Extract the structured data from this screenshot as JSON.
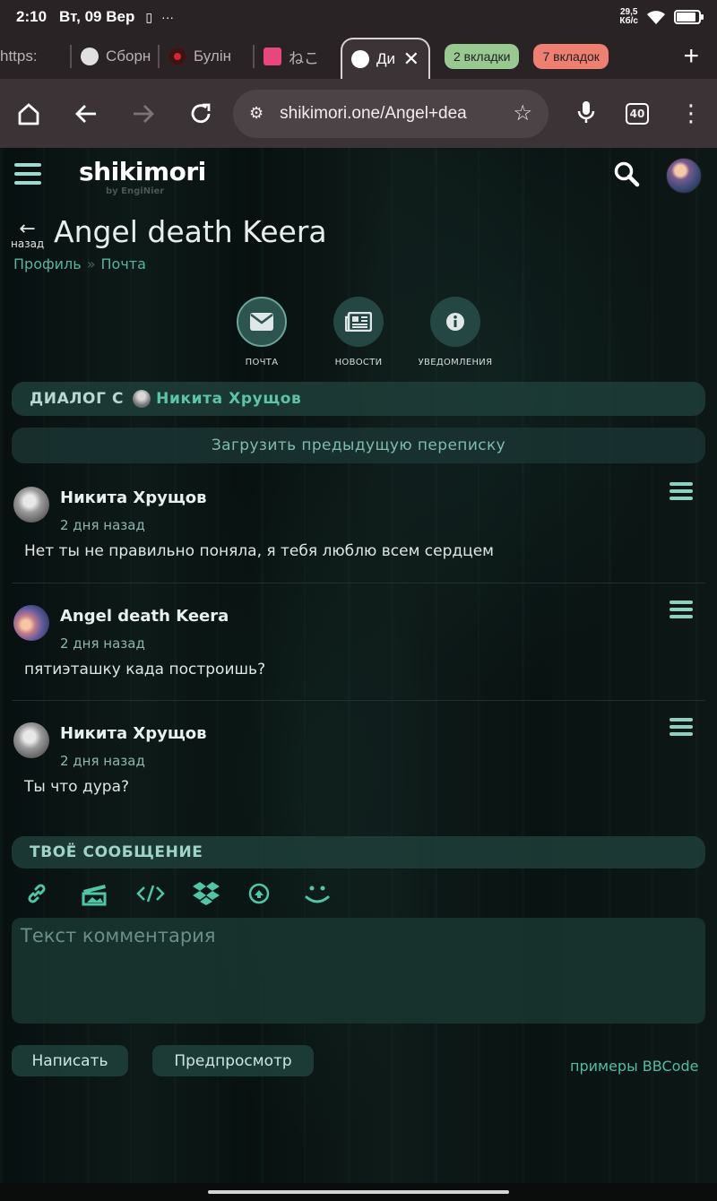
{
  "status": {
    "time": "2:10",
    "date": "Вт, 09 Вер",
    "speed_value": "29,5",
    "speed_unit": "Кб/с",
    "battery_level": 0.8
  },
  "tabs": {
    "items": [
      {
        "label": "https:",
        "favicon_color": "#5b5154"
      },
      {
        "label": "Сборн",
        "favicon_color": "#e0e0e0"
      },
      {
        "label": "Булін",
        "favicon_color": "#d7262e"
      },
      {
        "label": "ねこ",
        "favicon_color": "#e8467c"
      },
      {
        "label": "Ди",
        "favicon_color": "#ffffff",
        "active": true
      }
    ],
    "group_green": "2 вкладки",
    "group_red": "7 вкладок",
    "accent_green": "#98c98f",
    "accent_red": "#ee7f71"
  },
  "omnibox": {
    "url": "shikimori.one/Angel+dea",
    "tab_count": "40"
  },
  "site": {
    "logo": "shikimori",
    "logo_sub": "by EngiNier",
    "back_label": "назад",
    "page_title": "Angel death Keera",
    "breadcrumbs": [
      "Профиль",
      "Почта"
    ],
    "accent": "#5cc4a9"
  },
  "subnav": [
    {
      "label": "ПОЧТА",
      "icon": "envelope-icon"
    },
    {
      "label": "НОВОСТИ",
      "icon": "newspaper-icon"
    },
    {
      "label": "УВЕДОМЛЕНИЯ",
      "icon": "info-icon"
    }
  ],
  "dialog": {
    "heading": "ДИАЛОГ С",
    "with_user": "Никита Хрущов",
    "load_more": "Загрузить предыдущую переписку",
    "messages": [
      {
        "author": "Никита Хрущов",
        "time": "2 дня назад",
        "text": "Нет ты не правильно поняла, я тебя люблю всем сердцем"
      },
      {
        "author": "Angel death Keera",
        "time": "2 дня назад",
        "text": "пятиэташку када построишь?"
      },
      {
        "author": "Никита Хрущов",
        "time": "2 дня назад",
        "text": "Ты что дура?"
      }
    ]
  },
  "composer": {
    "heading": "ТВОЁ СООБЩЕНИЕ",
    "tools": [
      "link-icon",
      "image-icon",
      "code-icon",
      "dropbox-icon",
      "upload-icon",
      "smile-icon"
    ],
    "placeholder": "Текст комментария",
    "submit": "Написать",
    "preview": "Предпросмотр",
    "bbcode_link": "примеры BBCode"
  }
}
